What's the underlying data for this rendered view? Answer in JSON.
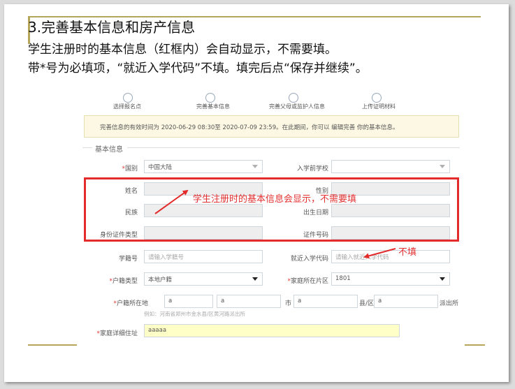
{
  "heading": {
    "title": "3.完善基本信息和房产信息",
    "line1": "学生注册时的基本信息（红框内）会自动显示，不需要填。",
    "line2": "带*号为必填项，“就近入学代码”不填。填完后点“保存并继续”。"
  },
  "steps": [
    "选择报名点",
    "完善基本信息",
    "完善父母或监护人信息",
    "上传证明材料"
  ],
  "notice": "完善信息的有效时间为 2020-06-29 08:30至 2020-07-09 23:59。在此期间，你可以 编辑完善 你的基本信息。",
  "section_title": "基本信息",
  "form": {
    "nationality_label": "国别",
    "nationality_value": "中国大陆",
    "preschool_label": "入学前学校",
    "name_label": "姓名",
    "gender_label": "性别",
    "ethnic_label": "民族",
    "birth_label": "出生日期",
    "id_type_label": "身份证件类型",
    "id_no_label": "证件号码",
    "student_no_label": "学籍号",
    "student_no_placeholder": "请输入学籍号",
    "nearby_label": "就近入学代码",
    "nearby_placeholder": "请输入就近入学代码",
    "huji_type_label": "户籍类型",
    "huji_type_value": "本地户籍",
    "district_label": "家庭所在片区",
    "district_value": "1801",
    "huji_addr_label": "户籍所在地",
    "province_value": "a",
    "city_value": "a",
    "city_suffix": "市",
    "county_value": "a",
    "county_suffix": "县/区",
    "town_value": "a",
    "town_suffix": "派出所",
    "addr_hint": "例如：河南省郑州市金水县/区黄河路派出所",
    "home_addr_label": "家庭详细住址",
    "home_addr_value": "aaaaa",
    "required_mark": "*"
  },
  "annotations": {
    "auto_display": "学生注册时的基本信息会显示，不需要填",
    "no_fill": "不填"
  },
  "colors": {
    "annotation_red": "#e32b2b",
    "accent_olive": "#b6a65a",
    "notice_bg": "#fcf8e3"
  }
}
